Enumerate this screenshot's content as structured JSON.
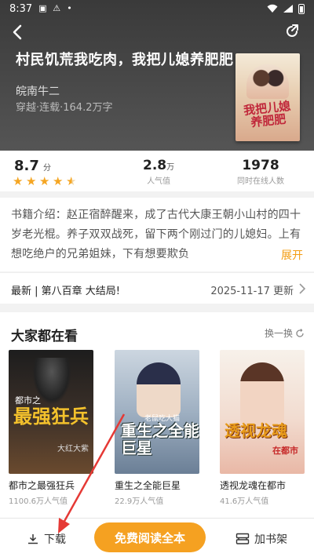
{
  "status_bar": {
    "time": "8:37"
  },
  "book": {
    "title": "村民饥荒我吃肉，我把儿媳养肥肥",
    "author": "皖南牛二",
    "meta": "穿越·连载·164.2万字",
    "cover_text": "我把儿媳养肥肥"
  },
  "stats": {
    "score": "8.7",
    "score_unit": "分",
    "stars": 4.5,
    "popularity": "2.8",
    "popularity_unit": "万",
    "popularity_label": "人气值",
    "online": "1978",
    "online_label": "同时在线人数"
  },
  "intro": {
    "text": "书籍介绍：赵正宿醉醒来，成了古代大康王朝小山村的四十岁老光棍。养子双双战死，留下两个刚过门的儿媳妇。上有想吃绝户的兄弟姐妹，下有想要欺负",
    "expand_label": "展开"
  },
  "latest": {
    "chapter": "最新 | 第八百章 大结局!",
    "updated": "2025-11-17 更新"
  },
  "recommendations": {
    "title": "大家都在看",
    "refresh_label": "换一换",
    "items": [
      {
        "name": "都市之最强狂兵",
        "popularity": "1100.6万人气值",
        "cover_title": "最强狂兵",
        "cover_sub": "都市之",
        "cover_author": "大红大紫"
      },
      {
        "name": "重生之全能巨星",
        "popularity": "22.9万人气值",
        "cover_title": "重生之全能巨星",
        "cover_author": "老鼠吃大猫"
      },
      {
        "name": "透视龙魂在都市",
        "popularity": "41.6万人气值",
        "cover_title": "透视龙魂",
        "cover_sub": "在都市"
      }
    ]
  },
  "bottom_bar": {
    "download_label": "下载",
    "read_label": "免费阅读全本",
    "shelf_label": "加书架"
  },
  "colors": {
    "accent": "#f5a121",
    "expand": "#f39c12",
    "arrow": "#e53935"
  }
}
